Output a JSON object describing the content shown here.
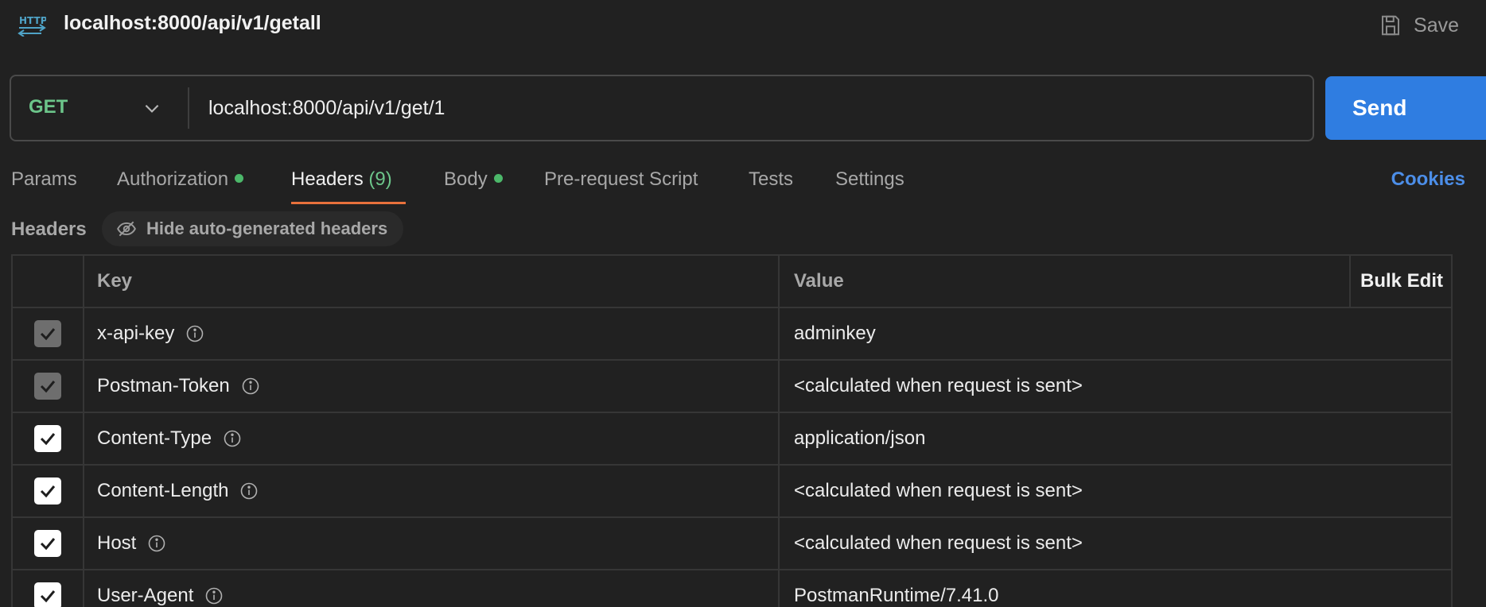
{
  "request": {
    "title": "localhost:8000/api/v1/getall",
    "save_label": "Save",
    "method": "GET",
    "url": "localhost:8000/api/v1/get/1",
    "send_label": "Send"
  },
  "tabs": [
    {
      "label": "Params"
    },
    {
      "label": "Authorization"
    },
    {
      "label": "Headers",
      "count": "(9)"
    },
    {
      "label": "Body"
    },
    {
      "label": "Pre-request Script"
    },
    {
      "label": "Tests"
    },
    {
      "label": "Settings"
    }
  ],
  "cookies_label": "Cookies",
  "headers_section": {
    "title": "Headers",
    "hide_auto_label": "Hide auto-generated headers"
  },
  "table": {
    "key_header": "Key",
    "value_header": "Value",
    "bulk_edit_label": "Bulk Edit",
    "rows": [
      {
        "key": "x-api-key",
        "value": "adminkey",
        "checked": true,
        "auto": true
      },
      {
        "key": "Postman-Token",
        "value": "<calculated when request is sent>",
        "checked": true,
        "auto": true
      },
      {
        "key": "Content-Type",
        "value": "application/json",
        "checked": true,
        "auto": false
      },
      {
        "key": "Content-Length",
        "value": "<calculated when request is sent>",
        "checked": true,
        "auto": false
      },
      {
        "key": "Host",
        "value": "<calculated when request is sent>",
        "checked": true,
        "auto": false
      },
      {
        "key": "User-Agent",
        "value": "PostmanRuntime/7.41.0",
        "checked": true,
        "auto": false
      }
    ]
  },
  "colors": {
    "background": "#212121",
    "method_get": "#6cc58a",
    "send_button": "#2f7de1",
    "active_tab_underline": "#e8713c",
    "status_dot": "#4cb86a",
    "link": "#4c8ee8"
  },
  "icons": {
    "request_type": "http-icon",
    "save": "save-icon",
    "method_dropdown": "chevron-down-icon",
    "hide_auto": "eye-slash-icon",
    "info": "info-icon",
    "checkbox": "checkmark-icon"
  }
}
